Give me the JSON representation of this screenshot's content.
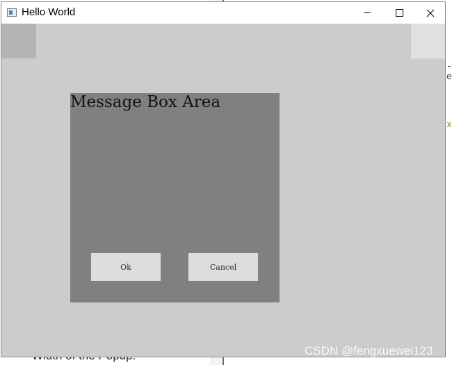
{
  "background": {
    "bottom_text": "Width of the Popup.",
    "side_snippet_1": "-e",
    "side_snippet_2": "xe"
  },
  "window": {
    "title": "Hello World",
    "controls": {
      "minimize_icon": "minimize-icon",
      "maximize_icon": "maximize-icon",
      "close_glyph": "✕"
    }
  },
  "message_box": {
    "title": "Message Box Area",
    "ok_label": "Ok",
    "cancel_label": "Cancel"
  },
  "watermark": "CSDN @fengxuewei123",
  "colors": {
    "client_bg": "#cccccc",
    "message_box_bg": "#808080",
    "button_bg": "#dddddd",
    "corner_left": "#b3b3b3",
    "corner_right": "#e0e0e0"
  }
}
